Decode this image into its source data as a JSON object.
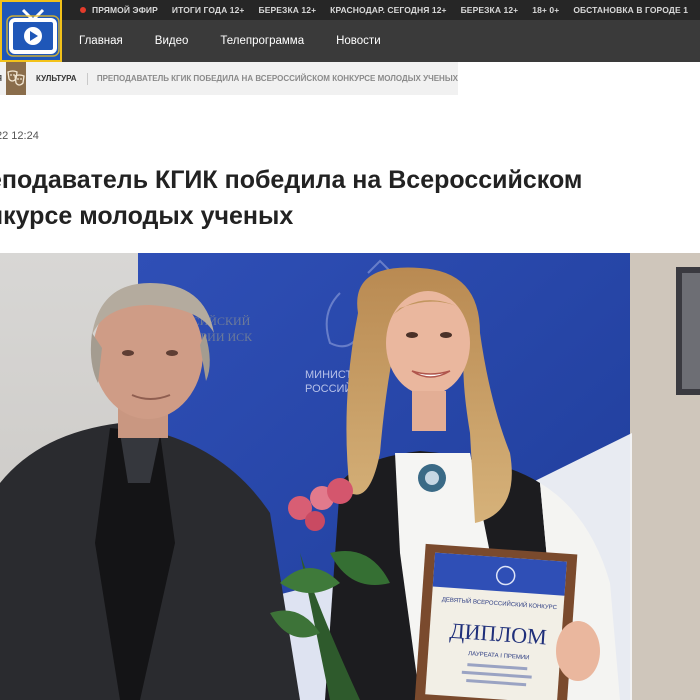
{
  "header": {
    "ticker": [
      {
        "label": "ПРЯМОЙ ЭФИР",
        "live": true
      },
      {
        "label": "ИТОГИ ГОДА 12+"
      },
      {
        "label": "БЕРЕЗКА 12+"
      },
      {
        "label": "КРАСНОДАР. СЕГОДНЯ 12+"
      },
      {
        "label": "БЕРЕЗКА 12+"
      },
      {
        "label": "18+ 0+"
      },
      {
        "label": "ОБСТАНОВКА В ГОРОДЕ 1"
      }
    ],
    "nav": [
      "Главная",
      "Видео",
      "Телепрограмма",
      "Новости"
    ]
  },
  "breadcrumb": {
    "prev": "ИЯ",
    "category": "КУЛЬТУРА",
    "current": "ПРЕПОДАВАТЕЛЬ КГИК ПОБЕДИЛА НА ВСЕРОССИЙСКОМ КОНКУРСЕ МОЛОДЫХ УЧЕНЫХ"
  },
  "article": {
    "datetime": "22 12:24",
    "title_line1": "еподаватель КГИК победила на Всероссийском",
    "title_line2": "нкурсе молодых ученых"
  },
  "photo": {
    "wall_text_1": "РОССИЙСКИЙ",
    "wall_text_2": "ИСТОРИИ ИСК",
    "banner_text_1": "МИНИСТЕРС",
    "banner_text_2": "РОССИЙСКО",
    "diploma_header": "ДЕВЯТЫЙ ВСЕРОССИЙСКИЙ КОНКУРС",
    "diploma_title": "ДИПЛОМ",
    "diploma_laureate": "ЛАУРЕАТА I ПРЕМИИ"
  },
  "colors": {
    "logo_bg": "#1f57b8",
    "logo_border": "#f3c21a",
    "topbar": "#3a3a3a",
    "live": "#e33b2b"
  }
}
